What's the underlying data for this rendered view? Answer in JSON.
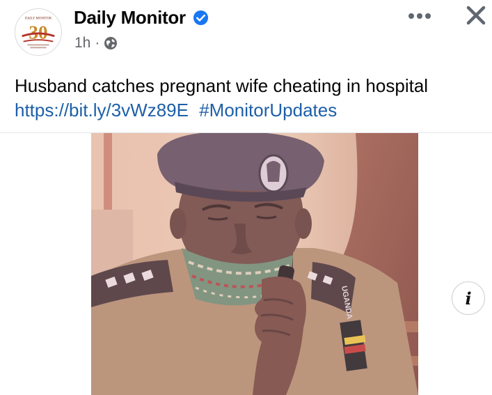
{
  "post": {
    "page_name": "Daily Monitor",
    "time": "1h",
    "separator": "·",
    "text": "Husband catches pregnant wife cheating in hospital",
    "link": "https://bit.ly/3vWz89E",
    "hashtag": "#MonitorUpdates"
  },
  "avatar": {
    "logo_number": "30",
    "logo_text": "DAILY MONITOR"
  },
  "photo": {
    "badge_text": "UGANDA",
    "info_glyph": "i"
  },
  "icons": {
    "verified": "verified-badge-icon",
    "privacy": "globe-icon",
    "more": "more-dots-icon",
    "close": "close-icon",
    "info": "info-icon"
  },
  "colors": {
    "link": "#1d5fa8",
    "verified": "#1877f2",
    "secondary_text": "#65676b"
  }
}
